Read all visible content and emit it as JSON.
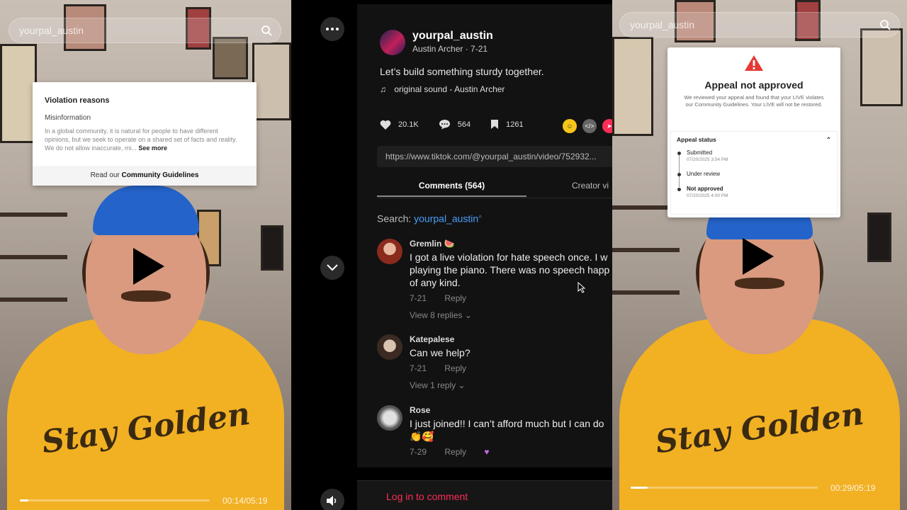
{
  "left_video": {
    "search_placeholder": "yourpal_austin",
    "time": "00:14/05:19",
    "progress": 0.045,
    "violation_card": {
      "title": "Violation reasons",
      "reason": "Misinformation",
      "body": "In a global community, it is natural for people to have different opinions, but we seek to operate on a shared set of facts and reality. We do not allow inaccurate, mi...",
      "see_more": "See more",
      "footer_prefix": "Read our",
      "footer_link": "Community Guidelines"
    },
    "shirt_text": "Stay Golden"
  },
  "right_video": {
    "search_placeholder": "yourpal_austin",
    "time": "00:29/05:19",
    "progress": 0.09,
    "appeal_card": {
      "title": "Appeal not approved",
      "description": "We reviewed your appeal and found that your LIVE violates our Community Guidelines. Your LIVE will not be restored.",
      "status_title": "Appeal status",
      "steps": [
        {
          "name": "Submitted",
          "timestamp": "07/20/2025 3:54 PM"
        },
        {
          "name": "Under review",
          "timestamp": ""
        },
        {
          "name": "Not approved",
          "timestamp": "07/20/2025 4:00 PM"
        }
      ]
    },
    "shirt_text": "Stay Golden"
  },
  "post": {
    "username": "yourpal_austin",
    "display_line": "Austin Archer · 7-21",
    "caption": "Let’s build something sturdy together.",
    "sound": "original sound - Austin Archer",
    "likes": "20.1K",
    "comments": "564",
    "saves": "1261",
    "link": "https://www.tiktok.com/@yourpal_austin/video/752932...",
    "tab_comments": "Comments (564)",
    "tab_creator": "Creator vi",
    "search_prefix": "Search:",
    "search_query": "yourpal_austin",
    "login_prompt": "Log in to comment"
  },
  "comments": [
    {
      "name": "Gremlin 🍉",
      "lines": [
        "I got a live violation for hate speech once. I w",
        "playing the piano. There was no speech happ",
        "of any kind."
      ],
      "date": "7-21",
      "reply": "Reply",
      "replies": "View 8 replies"
    },
    {
      "name": "Katepalese",
      "lines": [
        "Can we help?"
      ],
      "date": "7-21",
      "reply": "Reply",
      "replies": "View 1 reply"
    },
    {
      "name": "Rose",
      "lines": [
        "I just joined!! I can’t afford much but I can do",
        "👏🥰"
      ],
      "date": "7-29",
      "reply": "Reply",
      "replies": ""
    }
  ],
  "colors": {
    "accent": "#fe2c55",
    "link": "#4a9fff",
    "panel_bg": "#121212",
    "shirt": "#f2b023",
    "cap": "#2463c9"
  }
}
